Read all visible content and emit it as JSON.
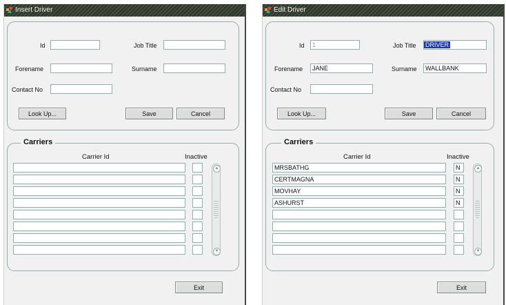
{
  "insert_window": {
    "title": "Insert Driver",
    "fields": {
      "id": {
        "label": "Id",
        "value": ""
      },
      "job_title": {
        "label": "Job Title",
        "value": ""
      },
      "forename": {
        "label": "Forename",
        "value": ""
      },
      "surname": {
        "label": "Surname",
        "value": ""
      },
      "contact_no": {
        "label": "Contact No",
        "value": ""
      }
    },
    "buttons": {
      "lookup": "Look Up...",
      "save": "Save",
      "cancel": "Cancel",
      "exit": "Exit"
    },
    "carriers": {
      "title": "Carriers",
      "col_carrier_id": "Carrier Id",
      "col_inactive": "Inactive",
      "rows": [
        {
          "carrier_id": "",
          "inactive": ""
        },
        {
          "carrier_id": "",
          "inactive": ""
        },
        {
          "carrier_id": "",
          "inactive": ""
        },
        {
          "carrier_id": "",
          "inactive": ""
        },
        {
          "carrier_id": "",
          "inactive": ""
        },
        {
          "carrier_id": "",
          "inactive": ""
        },
        {
          "carrier_id": "",
          "inactive": ""
        },
        {
          "carrier_id": "",
          "inactive": ""
        }
      ]
    }
  },
  "edit_window": {
    "title": "Edit Driver",
    "fields": {
      "id": {
        "label": "Id",
        "value": "1"
      },
      "job_title": {
        "label": "Job Title",
        "value": "DRIVER"
      },
      "forename": {
        "label": "Forename",
        "value": "JANE"
      },
      "surname": {
        "label": "Surname",
        "value": "WALLBANK"
      },
      "contact_no": {
        "label": "Contact No",
        "value": ""
      }
    },
    "buttons": {
      "lookup": "Look Up...",
      "save": "Save",
      "cancel": "Cancel",
      "exit": "Exit"
    },
    "carriers": {
      "title": "Carriers",
      "col_carrier_id": "Carrier Id",
      "col_inactive": "Inactive",
      "rows": [
        {
          "carrier_id": "MRSBATHG",
          "inactive": "N"
        },
        {
          "carrier_id": "CERTMAGNA",
          "inactive": "N"
        },
        {
          "carrier_id": "MOVHAY",
          "inactive": "N"
        },
        {
          "carrier_id": "ASHURST",
          "inactive": "N"
        },
        {
          "carrier_id": "",
          "inactive": ""
        },
        {
          "carrier_id": "",
          "inactive": ""
        },
        {
          "carrier_id": "",
          "inactive": ""
        },
        {
          "carrier_id": "",
          "inactive": ""
        }
      ]
    }
  },
  "colors": {
    "titlebar": "#2f3a2c",
    "field_border": "#8ab2ae",
    "selection": "#1d34c8",
    "panel_border": "#8fb1ad"
  }
}
